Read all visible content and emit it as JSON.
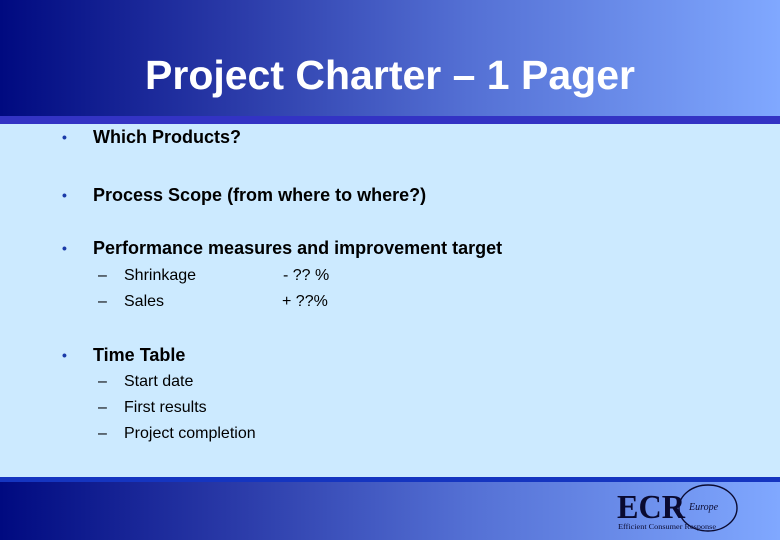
{
  "slide": {
    "title": "Project Charter – 1 Pager",
    "bullets": [
      {
        "marker": "•",
        "text": "Which Products?"
      },
      {
        "marker": "•",
        "text": "Process Scope (from where to where?)"
      },
      {
        "marker": "•",
        "text": "Performance measures and improvement target",
        "subitems": [
          {
            "marker": "–",
            "text": "Shrinkage",
            "value": "- ?? %"
          },
          {
            "marker": "–",
            "text": "Sales",
            "value": "+ ??%"
          }
        ]
      },
      {
        "marker": "•",
        "text": "Time Table",
        "subitems": [
          {
            "marker": "–",
            "text": "Start date"
          },
          {
            "marker": "–",
            "text": "First results"
          },
          {
            "marker": "–",
            "text": "Project completion"
          }
        ]
      }
    ]
  },
  "logo": {
    "main": "ECR",
    "region": "Europe",
    "tagline": "Efficient Consumer Response"
  },
  "colors": {
    "header_dark": "#000a80",
    "header_light": "#80a8ff",
    "divider": "#3333c4",
    "body_bg": "#cceaff",
    "bullet": "#1a3aa8"
  }
}
